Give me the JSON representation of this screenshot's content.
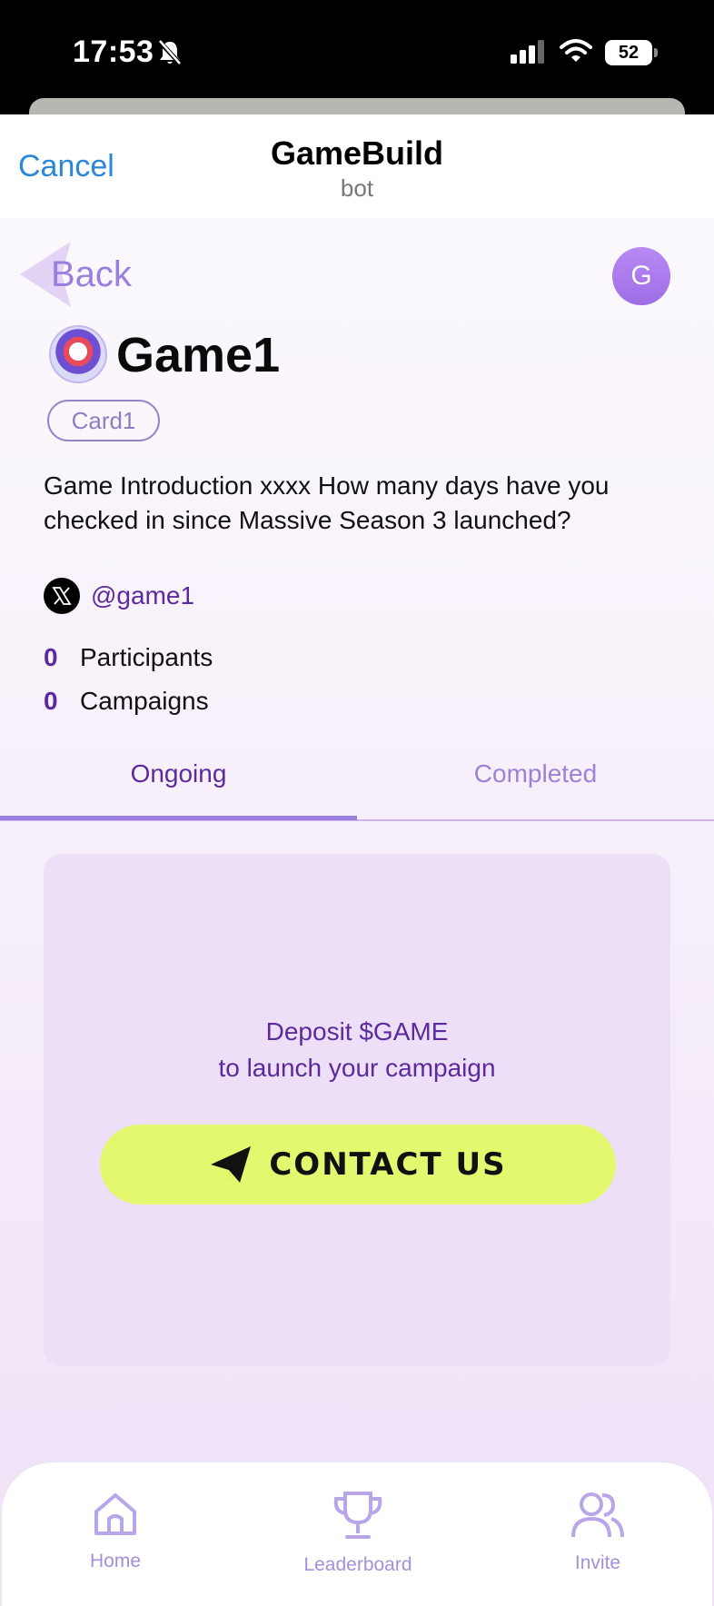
{
  "status_bar": {
    "time": "17:53",
    "battery": "52"
  },
  "header": {
    "cancel_label": "Cancel",
    "title": "GameBuild",
    "subtitle": "bot"
  },
  "nav": {
    "back_label": "Back",
    "avatar_initial": "G"
  },
  "game": {
    "name": "Game1",
    "tag": "Card1",
    "intro": "Game Introduction xxxx How many days have you checked in since Massive Season 3 launched?",
    "x_handle": "@game1",
    "stats": [
      {
        "count": "0",
        "label": "Participants"
      },
      {
        "count": "0",
        "label": "Campaigns"
      }
    ]
  },
  "tabs": [
    {
      "label": "Ongoing",
      "active": true
    },
    {
      "label": "Completed",
      "active": false
    }
  ],
  "campaign": {
    "deposit_line1": "Deposit $GAME",
    "deposit_line2": "to launch your campaign",
    "contact_label": "CONTACT US"
  },
  "bottom_nav": [
    {
      "label": "Home",
      "icon": "home-icon"
    },
    {
      "label": "Leaderboard",
      "icon": "trophy-icon"
    },
    {
      "label": "Invite",
      "icon": "users-icon"
    }
  ],
  "colors": {
    "accent_purple": "#5c2a9d",
    "light_purple": "#9a7fe0",
    "cta_lime": "#e3f86f",
    "cancel_blue": "#2a86d6"
  }
}
